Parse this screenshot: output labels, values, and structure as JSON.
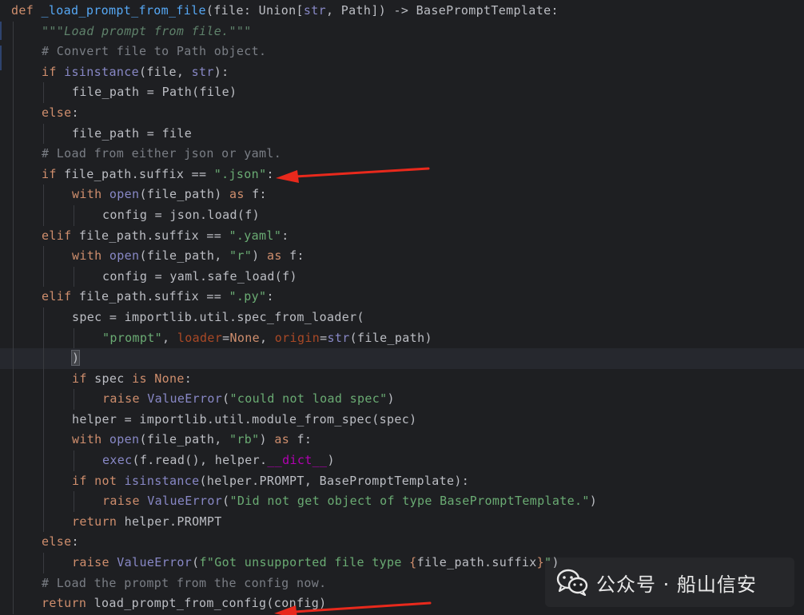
{
  "lines": [
    {
      "indent": 0,
      "tokens": [
        {
          "c": "t-kw",
          "t": "def "
        },
        {
          "c": "t-fn",
          "t": "_load_prompt_from_file"
        },
        {
          "c": "t-plain",
          "t": "(file: Union["
        },
        {
          "c": "t-bi",
          "t": "str"
        },
        {
          "c": "t-plain",
          "t": ", Path]) -> BasePromptTemplate:"
        }
      ]
    },
    {
      "indent": 1,
      "tokens": [
        {
          "c": "t-doc",
          "t": "\"\"\"Load prompt from file.\"\"\""
        }
      ]
    },
    {
      "indent": 1,
      "tokens": [
        {
          "c": "t-cmt",
          "t": "# Convert file to Path object."
        }
      ]
    },
    {
      "indent": 1,
      "tokens": [
        {
          "c": "t-kw",
          "t": "if "
        },
        {
          "c": "t-bi",
          "t": "isinstance"
        },
        {
          "c": "t-plain",
          "t": "(file, "
        },
        {
          "c": "t-bi",
          "t": "str"
        },
        {
          "c": "t-plain",
          "t": "):"
        }
      ]
    },
    {
      "indent": 2,
      "tokens": [
        {
          "c": "t-plain",
          "t": "file_path = Path(file)"
        }
      ]
    },
    {
      "indent": 1,
      "tokens": [
        {
          "c": "t-kw",
          "t": "else"
        },
        {
          "c": "t-plain",
          "t": ":"
        }
      ]
    },
    {
      "indent": 2,
      "tokens": [
        {
          "c": "t-plain",
          "t": "file_path = file"
        }
      ]
    },
    {
      "indent": 1,
      "tokens": [
        {
          "c": "t-cmt",
          "t": "# Load from either json or yaml."
        }
      ]
    },
    {
      "indent": 1,
      "tokens": [
        {
          "c": "t-kw",
          "t": "if "
        },
        {
          "c": "t-plain",
          "t": "file_path.suffix == "
        },
        {
          "c": "t-str",
          "t": "\".json\""
        },
        {
          "c": "t-plain",
          "t": ":"
        }
      ]
    },
    {
      "indent": 2,
      "tokens": [
        {
          "c": "t-kw",
          "t": "with "
        },
        {
          "c": "t-bi",
          "t": "open"
        },
        {
          "c": "t-plain",
          "t": "(file_path) "
        },
        {
          "c": "t-kw",
          "t": "as "
        },
        {
          "c": "t-plain",
          "t": "f:"
        }
      ]
    },
    {
      "indent": 3,
      "tokens": [
        {
          "c": "t-plain",
          "t": "config = json.load(f)"
        }
      ]
    },
    {
      "indent": 1,
      "tokens": [
        {
          "c": "t-kw",
          "t": "elif "
        },
        {
          "c": "t-plain",
          "t": "file_path.suffix == "
        },
        {
          "c": "t-str",
          "t": "\".yaml\""
        },
        {
          "c": "t-plain",
          "t": ":"
        }
      ]
    },
    {
      "indent": 2,
      "tokens": [
        {
          "c": "t-kw",
          "t": "with "
        },
        {
          "c": "t-bi",
          "t": "open"
        },
        {
          "c": "t-plain",
          "t": "(file_path, "
        },
        {
          "c": "t-str",
          "t": "\"r\""
        },
        {
          "c": "t-plain",
          "t": ") "
        },
        {
          "c": "t-kw",
          "t": "as "
        },
        {
          "c": "t-plain",
          "t": "f:"
        }
      ]
    },
    {
      "indent": 3,
      "tokens": [
        {
          "c": "t-plain",
          "t": "config = yaml.safe_load(f)"
        }
      ]
    },
    {
      "indent": 1,
      "tokens": [
        {
          "c": "t-kw",
          "t": "elif "
        },
        {
          "c": "t-plain",
          "t": "file_path.suffix == "
        },
        {
          "c": "t-str",
          "t": "\".py\""
        },
        {
          "c": "t-plain",
          "t": ":"
        }
      ]
    },
    {
      "indent": 2,
      "tokens": [
        {
          "c": "t-plain",
          "t": "spec = importlib.util.spec_from_loader("
        }
      ]
    },
    {
      "indent": 3,
      "tokens": [
        {
          "c": "t-str",
          "t": "\"prompt\""
        },
        {
          "c": "t-plain",
          "t": ", "
        },
        {
          "c": "t-param",
          "t": "loader"
        },
        {
          "c": "t-plain",
          "t": "="
        },
        {
          "c": "t-kw",
          "t": "None"
        },
        {
          "c": "t-plain",
          "t": ", "
        },
        {
          "c": "t-param",
          "t": "origin"
        },
        {
          "c": "t-plain",
          "t": "="
        },
        {
          "c": "t-bi",
          "t": "str"
        },
        {
          "c": "t-plain",
          "t": "(file_path)"
        }
      ]
    },
    {
      "indent": 2,
      "highlight": true,
      "tokens": [
        {
          "c": "t-bracket",
          "t": ")"
        }
      ]
    },
    {
      "indent": 2,
      "tokens": [
        {
          "c": "t-kw",
          "t": "if "
        },
        {
          "c": "t-plain",
          "t": "spec "
        },
        {
          "c": "t-kw",
          "t": "is None"
        },
        {
          "c": "t-plain",
          "t": ":"
        }
      ]
    },
    {
      "indent": 3,
      "tokens": [
        {
          "c": "t-kw",
          "t": "raise "
        },
        {
          "c": "t-bi",
          "t": "ValueError"
        },
        {
          "c": "t-plain",
          "t": "("
        },
        {
          "c": "t-str",
          "t": "\"could not load spec\""
        },
        {
          "c": "t-plain",
          "t": ")"
        }
      ]
    },
    {
      "indent": 2,
      "tokens": [
        {
          "c": "t-plain",
          "t": "helper = importlib.util.module_from_spec(spec)"
        }
      ]
    },
    {
      "indent": 2,
      "tokens": [
        {
          "c": "t-kw",
          "t": "with "
        },
        {
          "c": "t-bi",
          "t": "open"
        },
        {
          "c": "t-plain",
          "t": "(file_path, "
        },
        {
          "c": "t-str",
          "t": "\"rb\""
        },
        {
          "c": "t-plain",
          "t": ") "
        },
        {
          "c": "t-kw",
          "t": "as "
        },
        {
          "c": "t-plain",
          "t": "f:"
        }
      ]
    },
    {
      "indent": 3,
      "tokens": [
        {
          "c": "t-bi",
          "t": "exec"
        },
        {
          "c": "t-plain",
          "t": "(f.read(), helper."
        },
        {
          "c": "t-dunder",
          "t": "__dict__"
        },
        {
          "c": "t-plain",
          "t": ")"
        }
      ]
    },
    {
      "indent": 2,
      "tokens": [
        {
          "c": "t-kw",
          "t": "if not "
        },
        {
          "c": "t-bi",
          "t": "isinstance"
        },
        {
          "c": "t-plain",
          "t": "(helper.PROMPT, BasePromptTemplate):"
        }
      ]
    },
    {
      "indent": 3,
      "tokens": [
        {
          "c": "t-kw",
          "t": "raise "
        },
        {
          "c": "t-bi",
          "t": "ValueError"
        },
        {
          "c": "t-plain",
          "t": "("
        },
        {
          "c": "t-str",
          "t": "\"Did not get object of type BasePromptTemplate.\""
        },
        {
          "c": "t-plain",
          "t": ")"
        }
      ]
    },
    {
      "indent": 2,
      "tokens": [
        {
          "c": "t-kw",
          "t": "return "
        },
        {
          "c": "t-plain",
          "t": "helper.PROMPT"
        }
      ]
    },
    {
      "indent": 1,
      "tokens": [
        {
          "c": "t-kw",
          "t": "else"
        },
        {
          "c": "t-plain",
          "t": ":"
        }
      ]
    },
    {
      "indent": 2,
      "tokens": [
        {
          "c": "t-kw",
          "t": "raise "
        },
        {
          "c": "t-bi",
          "t": "ValueError"
        },
        {
          "c": "t-plain",
          "t": "("
        },
        {
          "c": "t-str",
          "t": "f\"Got unsupported file type "
        },
        {
          "c": "t-kw",
          "t": "{"
        },
        {
          "c": "t-plain",
          "t": "file_path.suffix"
        },
        {
          "c": "t-kw",
          "t": "}"
        },
        {
          "c": "t-str",
          "t": "\""
        },
        {
          "c": "t-plain",
          "t": ")"
        }
      ]
    },
    {
      "indent": 1,
      "tokens": [
        {
          "c": "t-cmt",
          "t": "# Load the prompt from the config now."
        }
      ]
    },
    {
      "indent": 1,
      "tokens": [
        {
          "c": "t-kw",
          "t": "return "
        },
        {
          "c": "t-plain",
          "t": "load_prompt_from_config(config)"
        }
      ]
    }
  ],
  "watermark": {
    "icon": "wechat-icon",
    "text": "公众号 · 船山信安"
  },
  "colors": {
    "background": "#1e1f22",
    "annotation_arrow": "#e8291c"
  }
}
